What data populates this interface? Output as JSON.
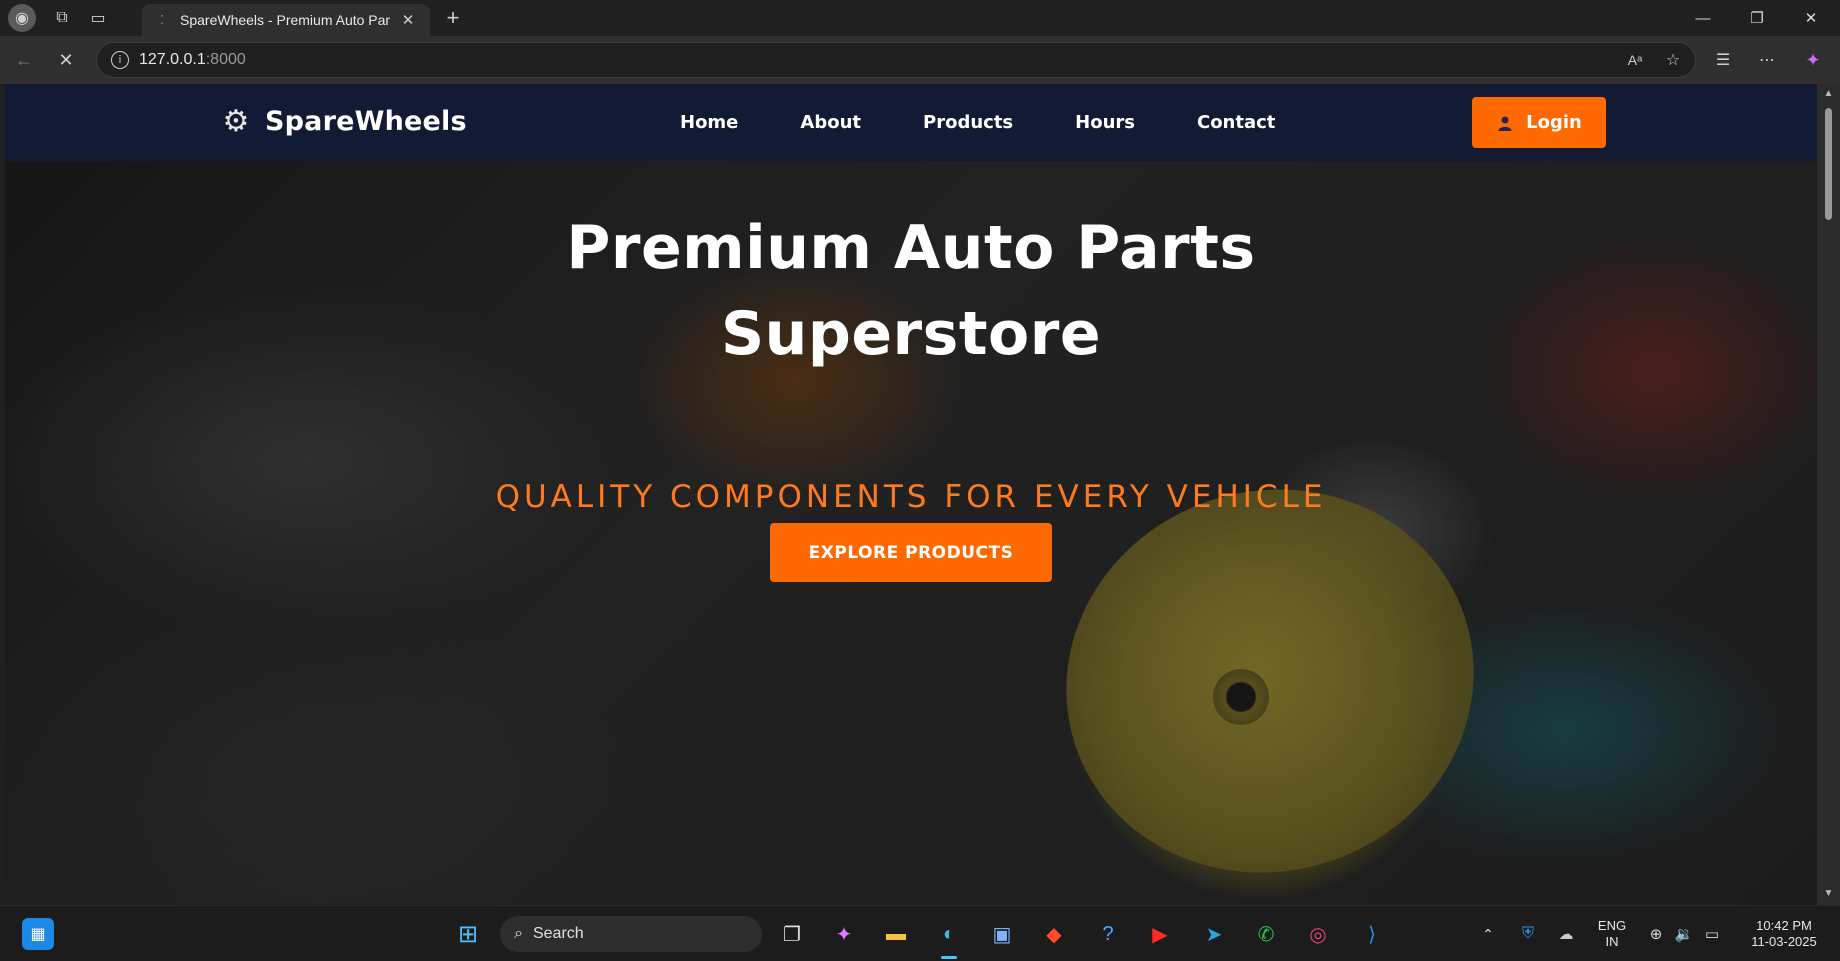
{
  "browser": {
    "tab_title": "SpareWheels - Premium Auto Par",
    "url_host": "127.0.0.1",
    "url_port": ":8000"
  },
  "site": {
    "brand": "SpareWheels",
    "nav": [
      "Home",
      "About",
      "Products",
      "Hours",
      "Contact"
    ],
    "login_label": "Login",
    "hero_title_line1": "Premium Auto Parts",
    "hero_title_line2": "Superstore",
    "hero_subtitle": "QUALITY COMPONENTS FOR EVERY VEHICLE",
    "cta_label": "EXPLORE PRODUCTS",
    "accent_color": "#ff6a00",
    "nav_bg": "#121b33"
  },
  "taskbar": {
    "search_label": "Search",
    "lang_line1": "ENG",
    "lang_line2": "IN",
    "time": "10:42 PM",
    "date": "11-03-2025"
  }
}
